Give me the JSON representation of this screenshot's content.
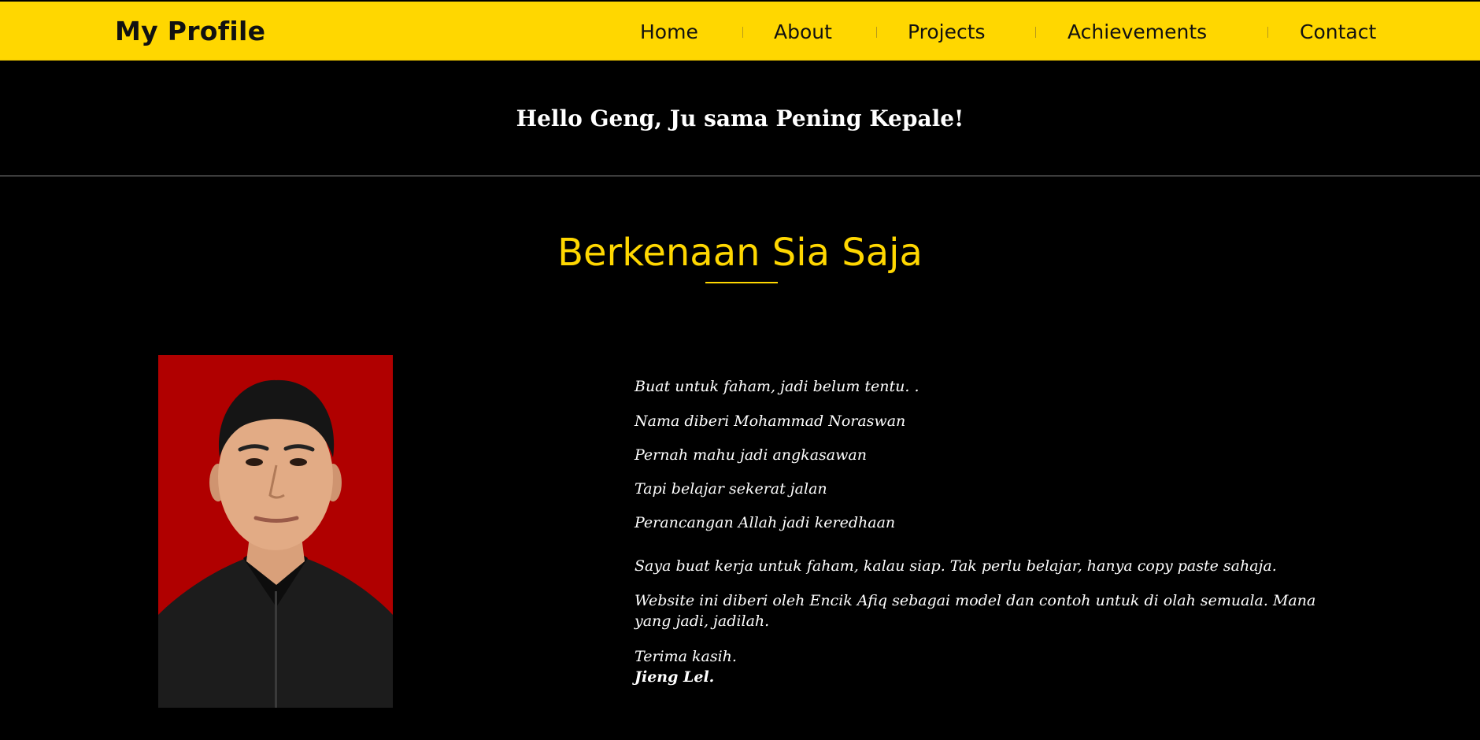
{
  "navbar": {
    "brand": "My Profile",
    "items": [
      {
        "label": "Home"
      },
      {
        "label": "About"
      },
      {
        "label": "Projects"
      },
      {
        "label": "Achievements"
      },
      {
        "label": "Contact"
      }
    ]
  },
  "hero": {
    "greeting": "Hello Geng, Ju sama Pening Kepale!"
  },
  "about": {
    "title": "Berkenaan Sia Saja",
    "lines": [
      "Buat untuk faham, jadi belum tentu. .",
      "Nama diberi Mohammad Noraswan",
      "Pernah mahu jadi angkasawan",
      "Tapi belajar sekerat jalan",
      "Perancangan Allah jadi keredhaan"
    ],
    "paragraph_1": "Saya buat kerja untuk faham, kalau siap. Tak perlu belajar, hanya copy paste sahaja.",
    "paragraph_2": "Website ini diberi oleh Encik Afiq sebagai model dan contoh untuk di olah semuala. Mana yang jadi, jadilah.",
    "closing": "Terima kasih.",
    "signature": "Jieng Lel."
  },
  "theme": {
    "accent": "#ffd700",
    "background": "#000000",
    "photo_background": "#b00000"
  }
}
